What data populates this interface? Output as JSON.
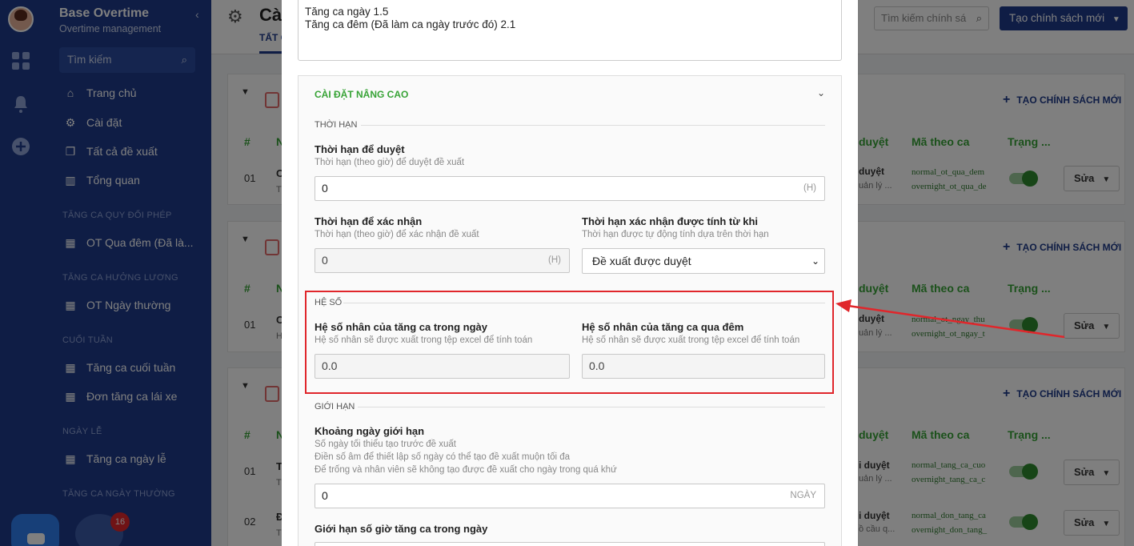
{
  "sidebar": {
    "app_name": "Base Overtime",
    "app_sub": "Overtime management",
    "search_placeholder": "Tìm kiếm",
    "items": [
      {
        "label": "Trang chủ"
      },
      {
        "label": "Cài đặt"
      },
      {
        "label": "Tất cả đề xuất"
      },
      {
        "label": "Tổng quan"
      }
    ],
    "sections": [
      {
        "title": "TĂNG CA QUY ĐỔI PHÉP",
        "items": [
          "OT Qua đêm (Đã là..."
        ]
      },
      {
        "title": "TĂNG CA HƯỞNG LƯƠNG",
        "items": [
          "OT Ngày thường"
        ]
      },
      {
        "title": "CUỐI TUẦN",
        "items": [
          "Tăng ca cuối tuần",
          "Đơn tăng ca lái xe"
        ]
      },
      {
        "title": "NGÀY LỄ",
        "items": [
          "Tăng ca ngày lễ"
        ]
      },
      {
        "title": "TĂNG CA NGÀY THƯỜNG",
        "items": []
      }
    ],
    "badge_count": "16"
  },
  "header": {
    "title": "Cài",
    "tab_all": "TẤT C",
    "search_placeholder": "Tìm kiếm chính sá",
    "new_button": "Tạo chính sách mới"
  },
  "cards": [
    {
      "add_label": "TẠO CHÍNH SÁCH MỚI",
      "headers": [
        "#",
        "N",
        "duyệt",
        "Mã theo ca",
        "Trạng ..."
      ],
      "rows": [
        {
          "no": "01",
          "name": "O",
          "sub": "T",
          "approve": "duyệt",
          "approve_sub": "uản lý ...",
          "codes": [
            "normal_ot_qua_dem",
            "overnight_ot_qua_de"
          ],
          "edit": "Sửa"
        }
      ]
    },
    {
      "add_label": "TẠO CHÍNH SÁCH MỚI",
      "headers": [
        "#",
        "N",
        "duyệt",
        "Mã theo ca",
        "Trạng ..."
      ],
      "rows": [
        {
          "no": "01",
          "name": "O",
          "sub": "H",
          "approve": "duyệt",
          "approve_sub": "uản lý ...",
          "codes": [
            "normal_ot_ngay_thu",
            "overnight_ot_ngay_t"
          ],
          "edit": "Sửa"
        }
      ]
    },
    {
      "add_label": "TẠO CHÍNH SÁCH MỚI",
      "headers": [
        "#",
        "N",
        "duyệt",
        "Mã theo ca",
        "Trạng ..."
      ],
      "rows": [
        {
          "no": "01",
          "name": "T",
          "sub": "T",
          "approve": "i duyệt",
          "approve_sub": "uản lý ...",
          "codes": [
            "normal_tang_ca_cuo",
            "overnight_tang_ca_c"
          ],
          "edit": "Sửa"
        },
        {
          "no": "02",
          "name": "Đ",
          "sub": "T",
          "approve": "i duyệt",
          "approve_sub": "ồ cầu q...",
          "codes": [
            "normal_don_tang_ca",
            "overnight_don_tang_"
          ],
          "edit": "Sửa"
        }
      ]
    }
  ],
  "modal": {
    "text_lines": [
      "Tăng ca ngày 1.5",
      "Tăng ca đêm (Đã làm ca ngày trước đó) 2.1"
    ],
    "advanced_title": "CÀI ĐẶT NÂNG CAO",
    "deadline": {
      "section": "THỜI HẠN",
      "approve_label": "Thời hạn để duyệt",
      "approve_help": "Thời hạn (theo giờ) để duyệt đề xuất",
      "approve_value": "0",
      "approve_unit": "(H)",
      "confirm_label": "Thời hạn để xác nhận",
      "confirm_help": "Thời hạn (theo giờ) để xác nhận đề xuất",
      "confirm_value": "0",
      "confirm_unit": "(H)",
      "from_label": "Thời hạn xác nhận được tính từ khi",
      "from_help": "Thời hạn được tự động tính dựa trên thời hạn",
      "from_value": "Đề xuất được duyệt"
    },
    "coefficient": {
      "section": "HỆ SỐ",
      "day_label": "Hệ số nhân của tăng ca trong ngày",
      "day_help": "Hệ số nhân sẽ được xuất trong tệp excel để tính toán",
      "day_value": "0.0",
      "night_label": "Hệ số nhân của tăng ca qua đêm",
      "night_help": "Hệ số nhân sẽ được xuất trong tệp excel để tính toán",
      "night_value": "0.0"
    },
    "limit": {
      "section": "GIỚI HẠN",
      "range_label": "Khoảng ngày giới hạn",
      "range_help": [
        "Số ngày tối thiểu tạo trước đề xuất",
        "Điền số âm để thiết lập số ngày có thể tạo đề xuất muộn tối đa",
        "Để trống và nhân viên sẽ không tạo được đề xuất cho ngày trong quá khứ"
      ],
      "range_value": "0",
      "range_unit": "NGÀY",
      "hours_label": "Giới hạn số giờ tăng ca trong ngày"
    }
  },
  "colors": {
    "sidebar": "#1e3a8a",
    "accent_green": "#37a336",
    "highlight_red": "#e0262b"
  }
}
